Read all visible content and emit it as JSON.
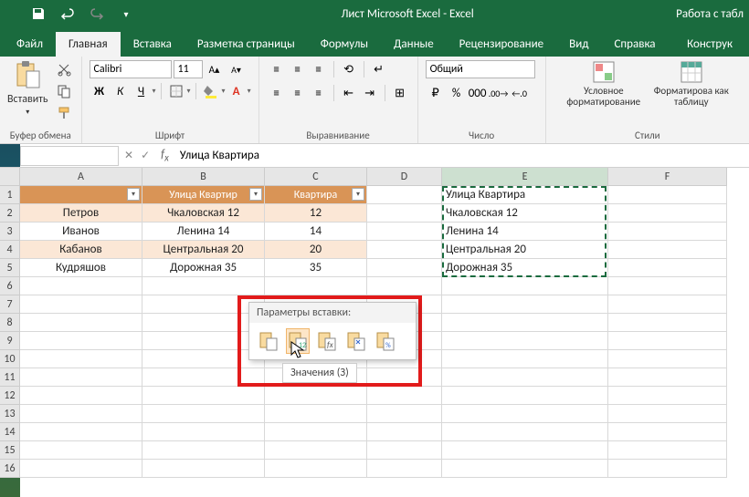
{
  "title": "Лист Microsoft Excel  -  Excel",
  "title_right": "Работа с табл",
  "tabs": {
    "file": "Файл",
    "home": "Главная",
    "insert": "Вставка",
    "layout": "Разметка страницы",
    "formulas": "Формулы",
    "data": "Данные",
    "review": "Рецензирование",
    "view": "Вид",
    "help": "Справка",
    "design": "Конструк"
  },
  "ribbon": {
    "clipboard": {
      "paste": "Вставить",
      "label": "Буфер обмена"
    },
    "font": {
      "name": "Calibri",
      "size": "11",
      "label": "Шрифт"
    },
    "alignment": {
      "label": "Выравнивание"
    },
    "number": {
      "format": "Общий",
      "label": "Число"
    },
    "styles": {
      "cond": "Условное форматирование",
      "table": "Форматирова как таблицу",
      "label": "Стили"
    }
  },
  "formula_bar": {
    "value": "Улица Квартира"
  },
  "columns": [
    "A",
    "B",
    "C",
    "D",
    "E",
    "F"
  ],
  "table": {
    "headers": {
      "A": "",
      "B": "Улица Квартир",
      "C": "Квартира"
    },
    "rows": [
      {
        "A": "Петров",
        "B": "Чкаловская 12",
        "C": "12"
      },
      {
        "A": "Иванов",
        "B": "Ленина 14",
        "C": "14"
      },
      {
        "A": "Кабанов",
        "B": "Центральная 20",
        "C": "20"
      },
      {
        "A": "Кудряшов",
        "B": "Дорожная 35",
        "C": "35"
      }
    ]
  },
  "pasted_col_E": [
    "Улица Квартира",
    "Чкаловская 12",
    "Ленина 14",
    "Центральная 20",
    "Дорожная 35"
  ],
  "paste_popup": {
    "title": "Параметры вставки:",
    "tooltip": "Значения (З)"
  },
  "row_count": 16
}
